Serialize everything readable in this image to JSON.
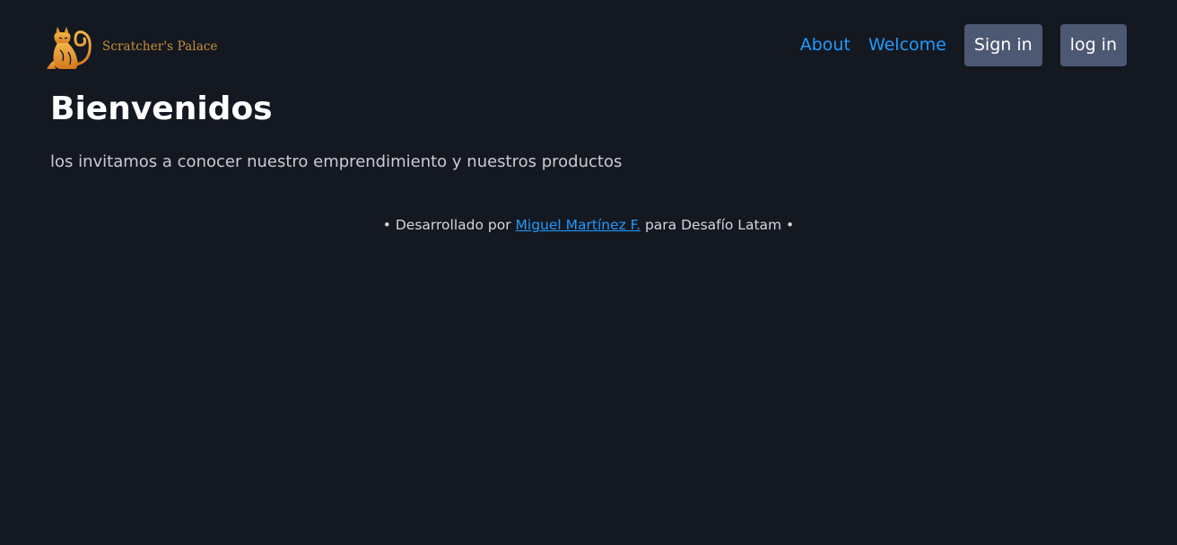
{
  "header": {
    "brand": {
      "name": "Scratcher's Palace",
      "logo_icon": "cat-logo-icon",
      "color": "#c88f3a"
    },
    "nav": {
      "about_label": "About",
      "welcome_label": "Welcome",
      "signin_label": "Sign in",
      "login_label": "log in"
    }
  },
  "hero": {
    "title": "Bienvenidos",
    "subtitle": "los invitamos a conocer nuestro emprendimiento y nuestros productos"
  },
  "footer": {
    "prefix": "• Desarrollado por ",
    "author_link": "Miguel Martínez F.",
    "suffix": " para Desafío Latam •"
  },
  "colors": {
    "background": "#141821",
    "link": "#1f9bff",
    "button_bg": "#4d5872",
    "brand": "#c88f3a"
  }
}
